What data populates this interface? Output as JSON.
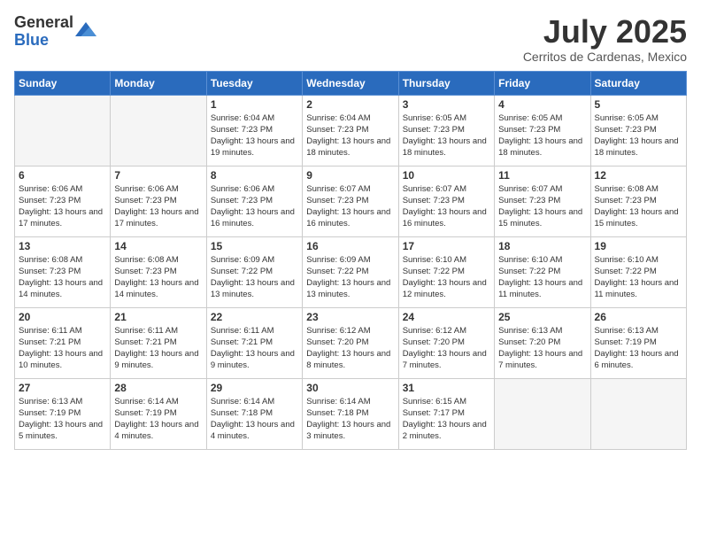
{
  "header": {
    "logo_general": "General",
    "logo_blue": "Blue",
    "month_title": "July 2025",
    "subtitle": "Cerritos de Cardenas, Mexico"
  },
  "days_of_week": [
    "Sunday",
    "Monday",
    "Tuesday",
    "Wednesday",
    "Thursday",
    "Friday",
    "Saturday"
  ],
  "weeks": [
    [
      {
        "day": "",
        "info": ""
      },
      {
        "day": "",
        "info": ""
      },
      {
        "day": "1",
        "info": "Sunrise: 6:04 AM\nSunset: 7:23 PM\nDaylight: 13 hours and 19 minutes."
      },
      {
        "day": "2",
        "info": "Sunrise: 6:04 AM\nSunset: 7:23 PM\nDaylight: 13 hours and 18 minutes."
      },
      {
        "day": "3",
        "info": "Sunrise: 6:05 AM\nSunset: 7:23 PM\nDaylight: 13 hours and 18 minutes."
      },
      {
        "day": "4",
        "info": "Sunrise: 6:05 AM\nSunset: 7:23 PM\nDaylight: 13 hours and 18 minutes."
      },
      {
        "day": "5",
        "info": "Sunrise: 6:05 AM\nSunset: 7:23 PM\nDaylight: 13 hours and 18 minutes."
      }
    ],
    [
      {
        "day": "6",
        "info": "Sunrise: 6:06 AM\nSunset: 7:23 PM\nDaylight: 13 hours and 17 minutes."
      },
      {
        "day": "7",
        "info": "Sunrise: 6:06 AM\nSunset: 7:23 PM\nDaylight: 13 hours and 17 minutes."
      },
      {
        "day": "8",
        "info": "Sunrise: 6:06 AM\nSunset: 7:23 PM\nDaylight: 13 hours and 16 minutes."
      },
      {
        "day": "9",
        "info": "Sunrise: 6:07 AM\nSunset: 7:23 PM\nDaylight: 13 hours and 16 minutes."
      },
      {
        "day": "10",
        "info": "Sunrise: 6:07 AM\nSunset: 7:23 PM\nDaylight: 13 hours and 16 minutes."
      },
      {
        "day": "11",
        "info": "Sunrise: 6:07 AM\nSunset: 7:23 PM\nDaylight: 13 hours and 15 minutes."
      },
      {
        "day": "12",
        "info": "Sunrise: 6:08 AM\nSunset: 7:23 PM\nDaylight: 13 hours and 15 minutes."
      }
    ],
    [
      {
        "day": "13",
        "info": "Sunrise: 6:08 AM\nSunset: 7:23 PM\nDaylight: 13 hours and 14 minutes."
      },
      {
        "day": "14",
        "info": "Sunrise: 6:08 AM\nSunset: 7:23 PM\nDaylight: 13 hours and 14 minutes."
      },
      {
        "day": "15",
        "info": "Sunrise: 6:09 AM\nSunset: 7:22 PM\nDaylight: 13 hours and 13 minutes."
      },
      {
        "day": "16",
        "info": "Sunrise: 6:09 AM\nSunset: 7:22 PM\nDaylight: 13 hours and 13 minutes."
      },
      {
        "day": "17",
        "info": "Sunrise: 6:10 AM\nSunset: 7:22 PM\nDaylight: 13 hours and 12 minutes."
      },
      {
        "day": "18",
        "info": "Sunrise: 6:10 AM\nSunset: 7:22 PM\nDaylight: 13 hours and 11 minutes."
      },
      {
        "day": "19",
        "info": "Sunrise: 6:10 AM\nSunset: 7:22 PM\nDaylight: 13 hours and 11 minutes."
      }
    ],
    [
      {
        "day": "20",
        "info": "Sunrise: 6:11 AM\nSunset: 7:21 PM\nDaylight: 13 hours and 10 minutes."
      },
      {
        "day": "21",
        "info": "Sunrise: 6:11 AM\nSunset: 7:21 PM\nDaylight: 13 hours and 9 minutes."
      },
      {
        "day": "22",
        "info": "Sunrise: 6:11 AM\nSunset: 7:21 PM\nDaylight: 13 hours and 9 minutes."
      },
      {
        "day": "23",
        "info": "Sunrise: 6:12 AM\nSunset: 7:20 PM\nDaylight: 13 hours and 8 minutes."
      },
      {
        "day": "24",
        "info": "Sunrise: 6:12 AM\nSunset: 7:20 PM\nDaylight: 13 hours and 7 minutes."
      },
      {
        "day": "25",
        "info": "Sunrise: 6:13 AM\nSunset: 7:20 PM\nDaylight: 13 hours and 7 minutes."
      },
      {
        "day": "26",
        "info": "Sunrise: 6:13 AM\nSunset: 7:19 PM\nDaylight: 13 hours and 6 minutes."
      }
    ],
    [
      {
        "day": "27",
        "info": "Sunrise: 6:13 AM\nSunset: 7:19 PM\nDaylight: 13 hours and 5 minutes."
      },
      {
        "day": "28",
        "info": "Sunrise: 6:14 AM\nSunset: 7:19 PM\nDaylight: 13 hours and 4 minutes."
      },
      {
        "day": "29",
        "info": "Sunrise: 6:14 AM\nSunset: 7:18 PM\nDaylight: 13 hours and 4 minutes."
      },
      {
        "day": "30",
        "info": "Sunrise: 6:14 AM\nSunset: 7:18 PM\nDaylight: 13 hours and 3 minutes."
      },
      {
        "day": "31",
        "info": "Sunrise: 6:15 AM\nSunset: 7:17 PM\nDaylight: 13 hours and 2 minutes."
      },
      {
        "day": "",
        "info": ""
      },
      {
        "day": "",
        "info": ""
      }
    ]
  ]
}
